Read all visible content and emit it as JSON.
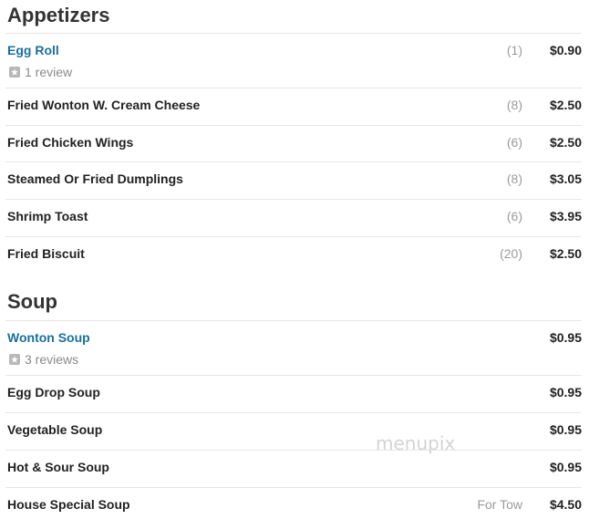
{
  "sections": [
    {
      "title": "Appetizers",
      "items": [
        {
          "name": "Egg Roll",
          "count": "(1)",
          "price": "$0.90",
          "review": "1 review"
        },
        {
          "name": "Fried Wonton W. Cream Cheese",
          "count": "(8)",
          "price": "$2.50"
        },
        {
          "name": "Fried Chicken Wings",
          "count": "(6)",
          "price": "$2.50"
        },
        {
          "name": "Steamed Or Fried Dumplings",
          "count": "(8)",
          "price": "$3.05"
        },
        {
          "name": "Shrimp Toast",
          "count": "(6)",
          "price": "$3.95"
        },
        {
          "name": "Fried Biscuit",
          "count": "(20)",
          "price": "$2.50"
        }
      ]
    },
    {
      "title": "Soup",
      "items": [
        {
          "name": "Wonton Soup",
          "price": "$0.95",
          "review": "3 reviews"
        },
        {
          "name": "Egg Drop Soup",
          "price": "$0.95"
        },
        {
          "name": "Vegetable Soup",
          "price": "$0.95"
        },
        {
          "name": "Hot & Sour Soup",
          "price": "$0.95"
        },
        {
          "name": "House Special Soup",
          "count": "For Tow",
          "price": "$4.50"
        }
      ]
    }
  ],
  "watermark": "menupix",
  "icons": {
    "review": "star-icon"
  },
  "colors": {
    "link": "#1a6fa0",
    "muted": "#9a9a9a",
    "rule": "#e6e6e6"
  }
}
